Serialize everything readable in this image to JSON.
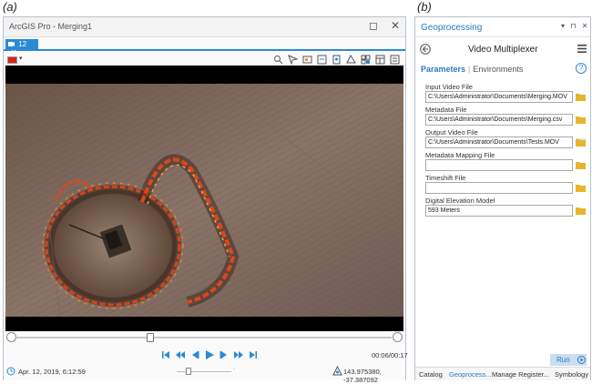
{
  "figure_labels": {
    "a": "(a)",
    "b": "(b)"
  },
  "window_a": {
    "title": "ArcGIS Pro - Merging1",
    "restore_glyph": "◻",
    "close_glyph": "✕",
    "tab": {
      "label": "12",
      "close_glyph": "✕"
    },
    "time_readout": "00:06/00:17",
    "date": "Apr. 12, 2019, 6:12:59",
    "coordinates": "143.975380, -37.387092",
    "zoom_dots": "·",
    "scrub_position_fraction": 0.36,
    "accent": "#2b8ad6",
    "swatch_color": "#e0201a"
  },
  "geoprocessing": {
    "pane_title": "Geoprocessing",
    "pane_controls": "▾ ⊓ ✕",
    "tool_title": "Video Multiplexer",
    "tabs": {
      "parameters": "Parameters",
      "separator": "|",
      "environments": "Environments"
    },
    "help_glyph": "?",
    "params": [
      {
        "label": "Input Video File",
        "value": "C:\\Users\\Administrator\\Documents\\Merging.MOV"
      },
      {
        "label": "Metadata File",
        "value": "C:\\Users\\Administrator\\Documents\\Merging.csv"
      },
      {
        "label": "Output Video File",
        "value": "C:\\Users\\Administrator\\Documents\\Tests.MOV"
      },
      {
        "label": "Metadata Mapping File",
        "value": ""
      },
      {
        "label": "Timeshift File",
        "value": ""
      },
      {
        "label": "Digital Elevation Model",
        "value": "593 Meters"
      }
    ],
    "run_label": "Run",
    "bottom_tabs": [
      "Catalog",
      "Geoprocess...",
      "Manage Register...",
      "Symbology"
    ]
  }
}
